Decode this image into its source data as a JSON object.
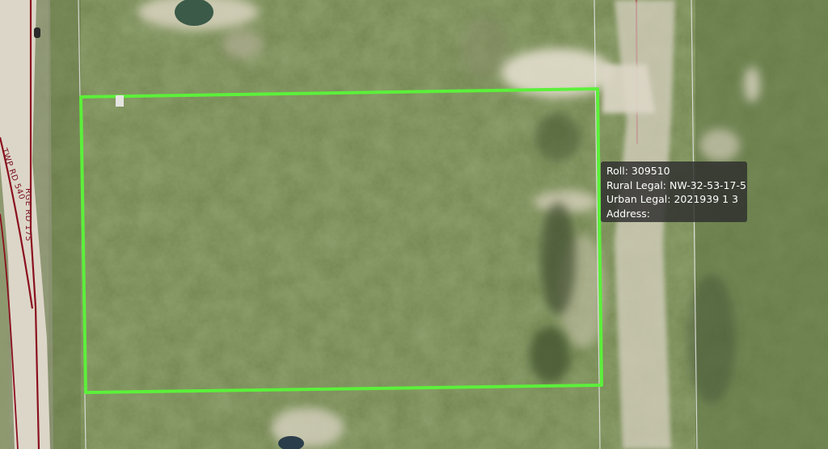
{
  "map": {
    "road_labels": [
      "RGE RD 175",
      "TWP RD 540"
    ],
    "parcel_outline_color": "#5cf03a",
    "road_line_color": "#8a0f1e",
    "road_color": "#dcd6c8",
    "boundary_line_color": "#e8e8e8"
  },
  "info_popup": {
    "roll_label": "Roll:",
    "roll_value": "309510",
    "rural_legal_label": "Rural Legal:",
    "rural_legal_value": "NW-32-53-17-5",
    "urban_legal_label": "Urban Legal:",
    "urban_legal_value": "2021939 1 3",
    "address_label": "Address:",
    "address_value": ""
  }
}
